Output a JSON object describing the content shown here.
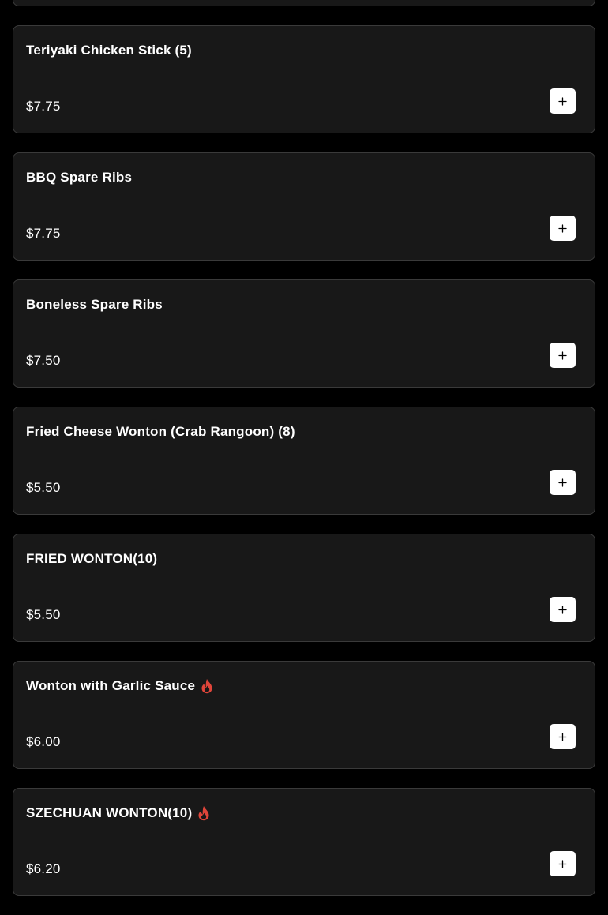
{
  "theme": {
    "background": "#000000",
    "card_background": "#181818",
    "card_border": "#3a3a3a",
    "text": "#ffffff",
    "add_button_background": "#ffffff",
    "add_button_icon": "#000000",
    "spicy_icon_color": "#e0453a"
  },
  "menu": {
    "items": [
      {
        "name": "",
        "price": "",
        "spicy": false,
        "add_icon": "plus-icon"
      },
      {
        "name": "Teriyaki Chicken Stick (5)",
        "price": "$7.75",
        "spicy": false,
        "add_icon": "plus-icon"
      },
      {
        "name": "BBQ Spare Ribs",
        "price": "$7.75",
        "spicy": false,
        "add_icon": "plus-icon"
      },
      {
        "name": "Boneless Spare Ribs",
        "price": "$7.50",
        "spicy": false,
        "add_icon": "plus-icon"
      },
      {
        "name": "Fried Cheese Wonton (Crab Rangoon) (8)",
        "price": "$5.50",
        "spicy": false,
        "add_icon": "plus-icon"
      },
      {
        "name": "FRIED WONTON(10)",
        "price": "$5.50",
        "spicy": false,
        "add_icon": "plus-icon"
      },
      {
        "name": "Wonton with Garlic Sauce",
        "price": "$6.00",
        "spicy": true,
        "spicy_icon": "flame-icon",
        "add_icon": "plus-icon"
      },
      {
        "name": "SZECHUAN WONTON(10)",
        "price": "$6.20",
        "spicy": true,
        "spicy_icon": "flame-icon",
        "add_icon": "plus-icon"
      }
    ]
  }
}
